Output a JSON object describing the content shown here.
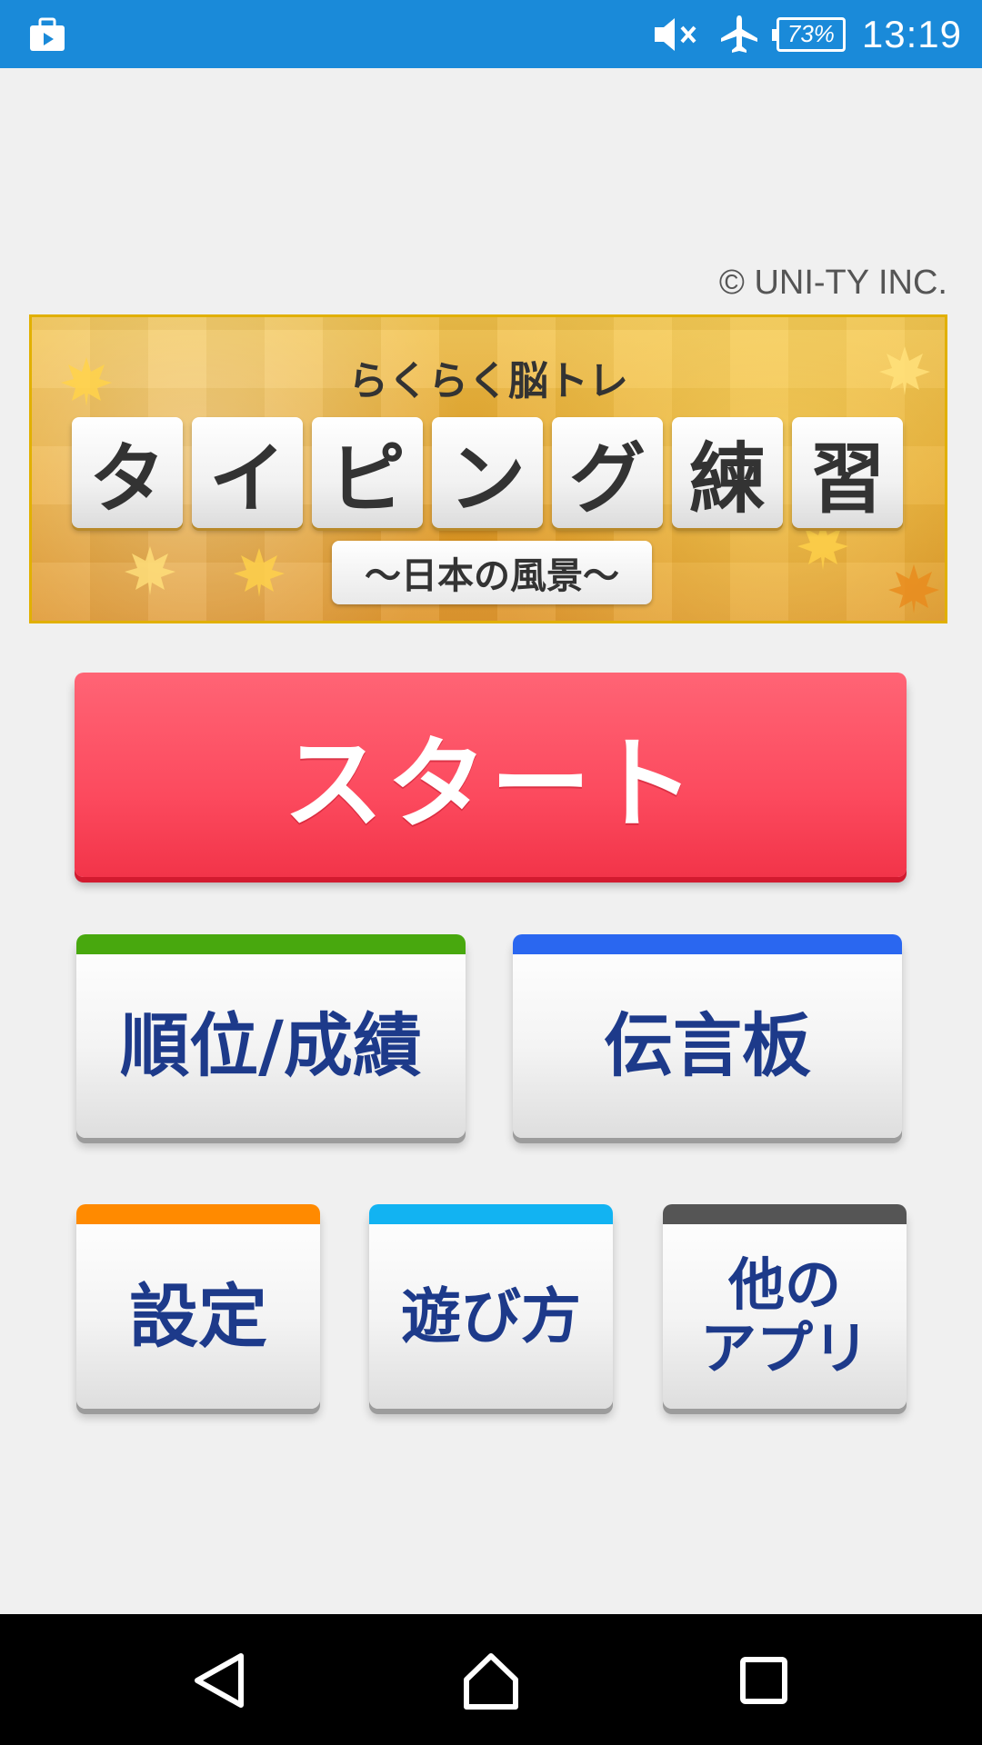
{
  "status_bar": {
    "battery": "73%",
    "time": "13:19",
    "icons": [
      "briefcase-icon",
      "mute-icon",
      "airplane-mode-icon",
      "battery-icon"
    ]
  },
  "copyright": "© UNI-TY INC.",
  "banner": {
    "subtitle": "らくらく脳トレ",
    "tiles": [
      "タ",
      "イ",
      "ピ",
      "ン",
      "グ",
      "練",
      "習"
    ],
    "tagline": "〜日本の風景〜"
  },
  "buttons": {
    "start": "スタート",
    "ranking": "順位/成績",
    "board": "伝言板",
    "settings": "設定",
    "howto": "遊び方",
    "other_apps": "他の\nアプリ"
  },
  "colors": {
    "status_bar": "#1a8ad9",
    "start": "#fc4a5e",
    "ranking_accent": "#48a80e",
    "board_accent": "#2a67f0",
    "settings_accent": "#ff8a00",
    "howto_accent": "#12b3f2",
    "other_apps_accent": "#555555",
    "menu_text": "#1d3a8a"
  },
  "nav_bar": {
    "icons": [
      "back-icon",
      "home-icon",
      "recents-icon"
    ]
  }
}
